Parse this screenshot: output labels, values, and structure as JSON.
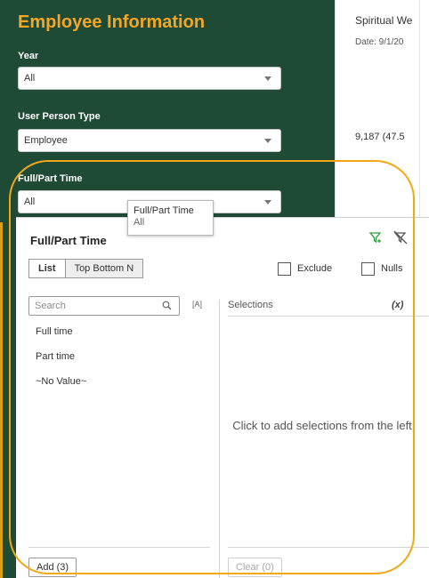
{
  "sidebar": {
    "title": "Employee Information",
    "filters": [
      {
        "label": "Year",
        "value": "All"
      },
      {
        "label": "User Person Type",
        "value": "Employee"
      },
      {
        "label": "Full/Part Time",
        "value": "All"
      }
    ]
  },
  "right_strip": {
    "title": "Spiritual We",
    "date": "Date: 9/1/20",
    "value": "9,187 (47.5"
  },
  "tooltip": {
    "title": "Full/Part Time",
    "value": "All"
  },
  "popup": {
    "title": "Full/Part Time",
    "tabs": [
      "List",
      "Top Bottom N"
    ],
    "exclude_label": "Exclude",
    "nulls_label": "Nulls",
    "search_placeholder": "Search",
    "sort_glyph": "[A]",
    "items": [
      "Full time",
      "Part time",
      "~No Value~"
    ],
    "selections_header": "Selections",
    "formula_glyph": "(x)",
    "empty_message": "Click to add selections from the left",
    "add_button": "Add (3)",
    "clear_button": "Clear (0)"
  },
  "colors": {
    "sidebar_bg": "#1f4a36",
    "title_accent": "#f5a623",
    "highlight_ring": "#f2a814",
    "filter_icon": "#2e9e3a"
  }
}
